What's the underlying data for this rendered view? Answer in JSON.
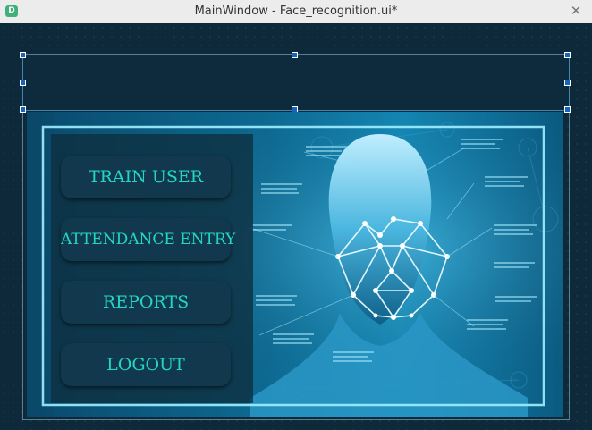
{
  "window": {
    "title": "MainWindow - Face_recognition.ui*",
    "app_icon_letter": "D",
    "close_glyph": "✕"
  },
  "menu": {
    "train_user": "TRAIN USER",
    "attendance_entry": "ATTENDANCE ENTRY",
    "reports": "REPORTS",
    "logout": "LOGOUT"
  },
  "icons": [
    "app-icon",
    "close-icon"
  ],
  "colors": {
    "button_text": "#23d6c4",
    "button_bg": "#11384c",
    "canvas_bg": "#0e2a3a",
    "selection_border": "#3f86b2"
  }
}
